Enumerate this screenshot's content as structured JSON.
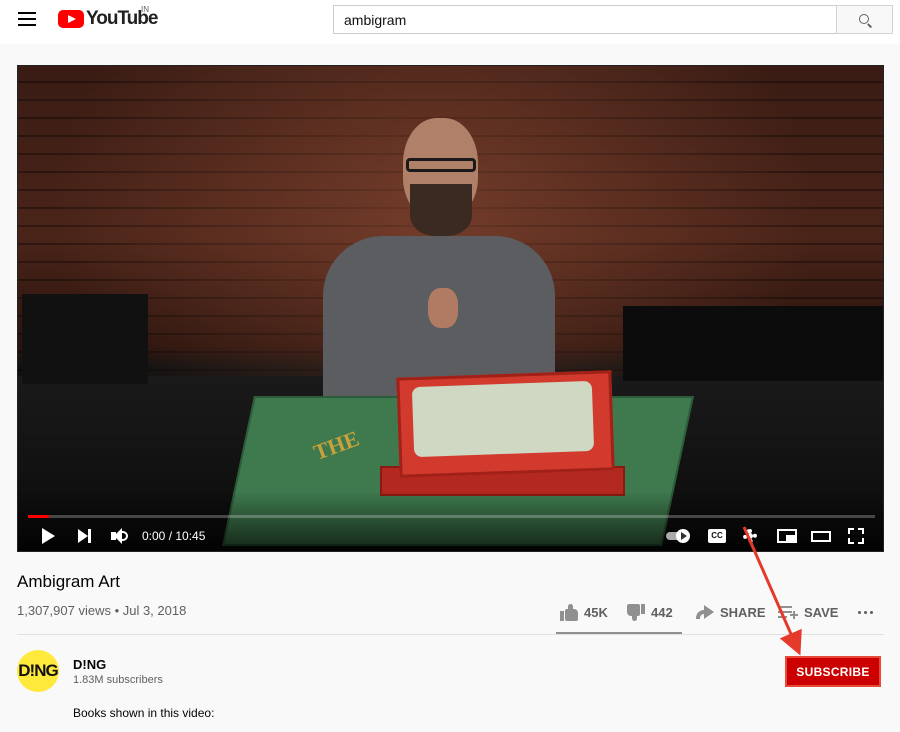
{
  "masthead": {
    "logo_text": "YouTube",
    "country_code": "IN",
    "search_value": "ambigram"
  },
  "player": {
    "time_display": "0:00 / 10:45",
    "progress_fraction": 0.0,
    "book_spine_text": "THE"
  },
  "video": {
    "title": "Ambigram Art",
    "meta": "1,307,907 views • Jul 3, 2018",
    "likes": "45K",
    "dislikes": "442",
    "share_label": "SHARE",
    "save_label": "SAVE"
  },
  "channel": {
    "avatar_text": "D!NG",
    "name": "D!NG",
    "subscribers": "1.83M subscribers",
    "subscribe_label": "SUBSCRIBE"
  },
  "description": {
    "first_line": "Books shown in this video:"
  },
  "colors": {
    "brand_red": "#ff0000",
    "subscribe_red": "#cc0000",
    "annotation_arrow": "#e53a2a",
    "avatar_yellow": "#ffe93b"
  },
  "icons": [
    "menu-icon",
    "youtube-logo-icon",
    "search-icon",
    "play-icon",
    "next-icon",
    "volume-icon",
    "autoplay-toggle-icon",
    "captions-icon",
    "settings-gear-icon",
    "miniplayer-icon",
    "theater-mode-icon",
    "fullscreen-icon",
    "thumbs-up-icon",
    "thumbs-down-icon",
    "share-icon",
    "save-playlist-icon",
    "more-options-icon"
  ]
}
